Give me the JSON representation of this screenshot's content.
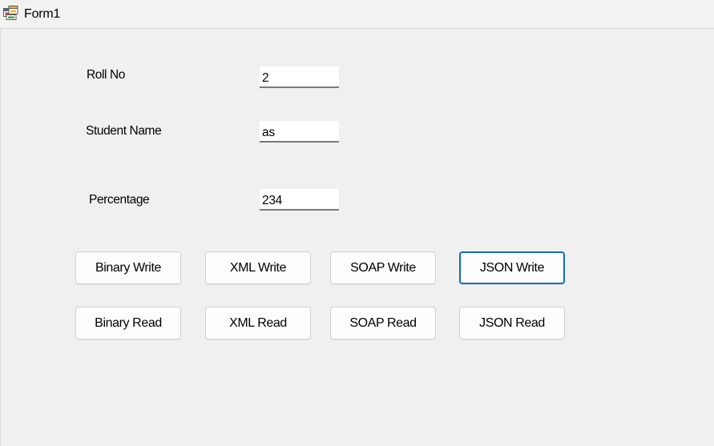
{
  "window": {
    "title": "Form1",
    "icon": "windows-form-icon"
  },
  "form": {
    "roll_no": {
      "label": "Roll No",
      "value": "2"
    },
    "student_name": {
      "label": "Student Name",
      "value": "as"
    },
    "percentage": {
      "label": "Percentage",
      "value": "234"
    }
  },
  "buttons": {
    "binary_write": "Binary Write",
    "xml_write": "XML Write",
    "soap_write": "SOAP Write",
    "json_write": "JSON Write",
    "binary_read": "Binary Read",
    "xml_read": "XML Read",
    "soap_read": "SOAP Read",
    "json_read": "JSON Read"
  },
  "colors": {
    "focus_border": "#0f6cbd",
    "background": "#f0f0f0"
  }
}
